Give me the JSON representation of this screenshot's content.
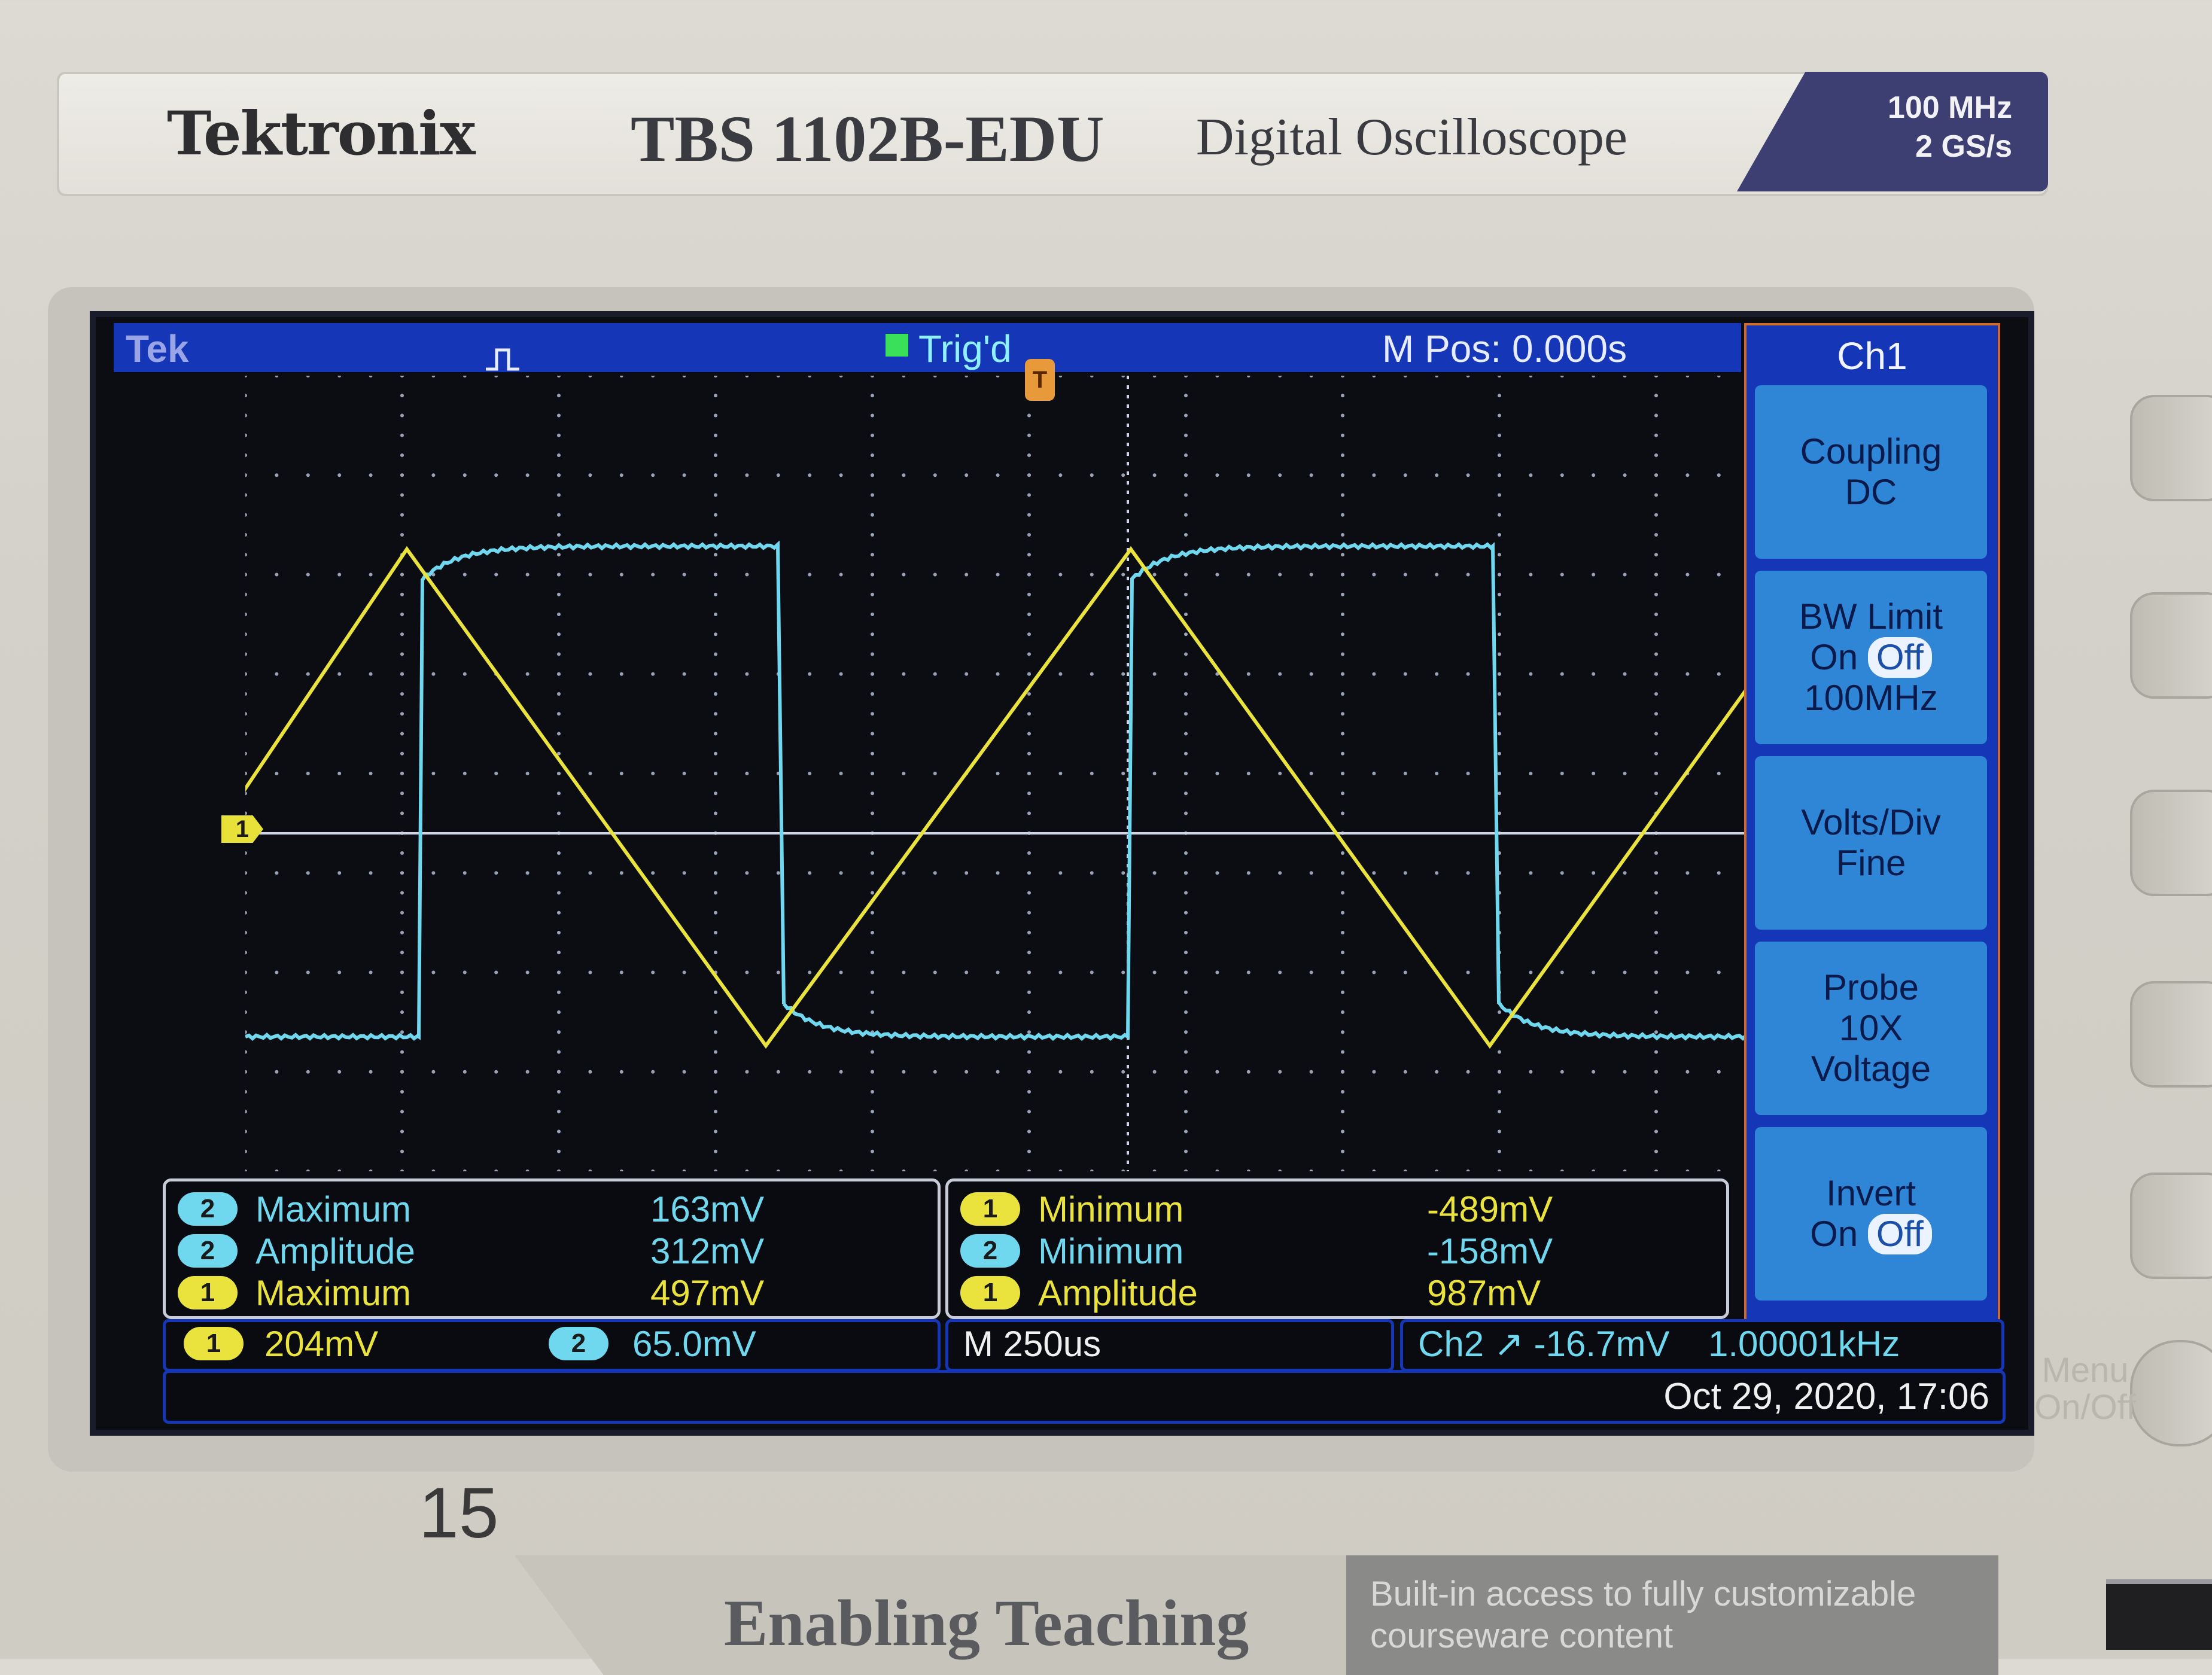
{
  "brand": {
    "logo": "Tektronix",
    "model": "TBS 1102B-EDU",
    "description": "Digital Oscilloscope",
    "spec_line1": "100 MHz",
    "spec_line2": "2 GS/s"
  },
  "status_bar": {
    "logo": "Tek",
    "trigger_status": "Trig'd",
    "main_position": "M Pos: 0.000s"
  },
  "side_menu": {
    "title": "Ch1",
    "buttons": [
      {
        "line1": "Coupling",
        "line2": "DC"
      },
      {
        "line1": "BW Limit",
        "on": "On",
        "off": "Off",
        "line3": "100MHz"
      },
      {
        "line1": "Volts/Div",
        "line2": "Fine"
      },
      {
        "line1": "Probe",
        "line2": "10X",
        "line3": "Voltage"
      },
      {
        "line1": "Invert",
        "on": "On",
        "off": "Off"
      }
    ]
  },
  "markers": {
    "ch1": "1",
    "trigger": "T"
  },
  "measurements": {
    "left": [
      {
        "ch": "2",
        "name": "Maximum",
        "value": "163mV"
      },
      {
        "ch": "2",
        "name": "Amplitude",
        "value": "312mV"
      },
      {
        "ch": "1",
        "name": "Maximum",
        "value": "497mV"
      }
    ],
    "right": [
      {
        "ch": "1",
        "name": "Minimum",
        "value": "-489mV"
      },
      {
        "ch": "2",
        "name": "Minimum",
        "value": "-158mV"
      },
      {
        "ch": "1",
        "name": "Amplitude",
        "value": "987mV"
      }
    ]
  },
  "scale": {
    "ch1_badge": "1",
    "ch1_scale": "204mV",
    "ch2_badge": "2",
    "ch2_scale": "65.0mV",
    "timebase": "M 250us",
    "trigger_info": "Ch2 ↗ -16.7mV",
    "frequency": "1.00001kHz"
  },
  "datetime": "Oct 29, 2020, 17:06",
  "panel": {
    "menu_onoff_line1": "Menu",
    "menu_onoff_line2": "On/Off",
    "page_number": "15",
    "banner_title": "Enabling Teaching",
    "banner_side_line1": "Built-in access to fully customizable",
    "banner_side_line2": "courseware content"
  },
  "colors": {
    "ch1_trace": "#eae33e",
    "ch2_trace": "#6fd8ef",
    "status_blue": "#1537b7",
    "menu_border": "#d06a2a"
  }
}
